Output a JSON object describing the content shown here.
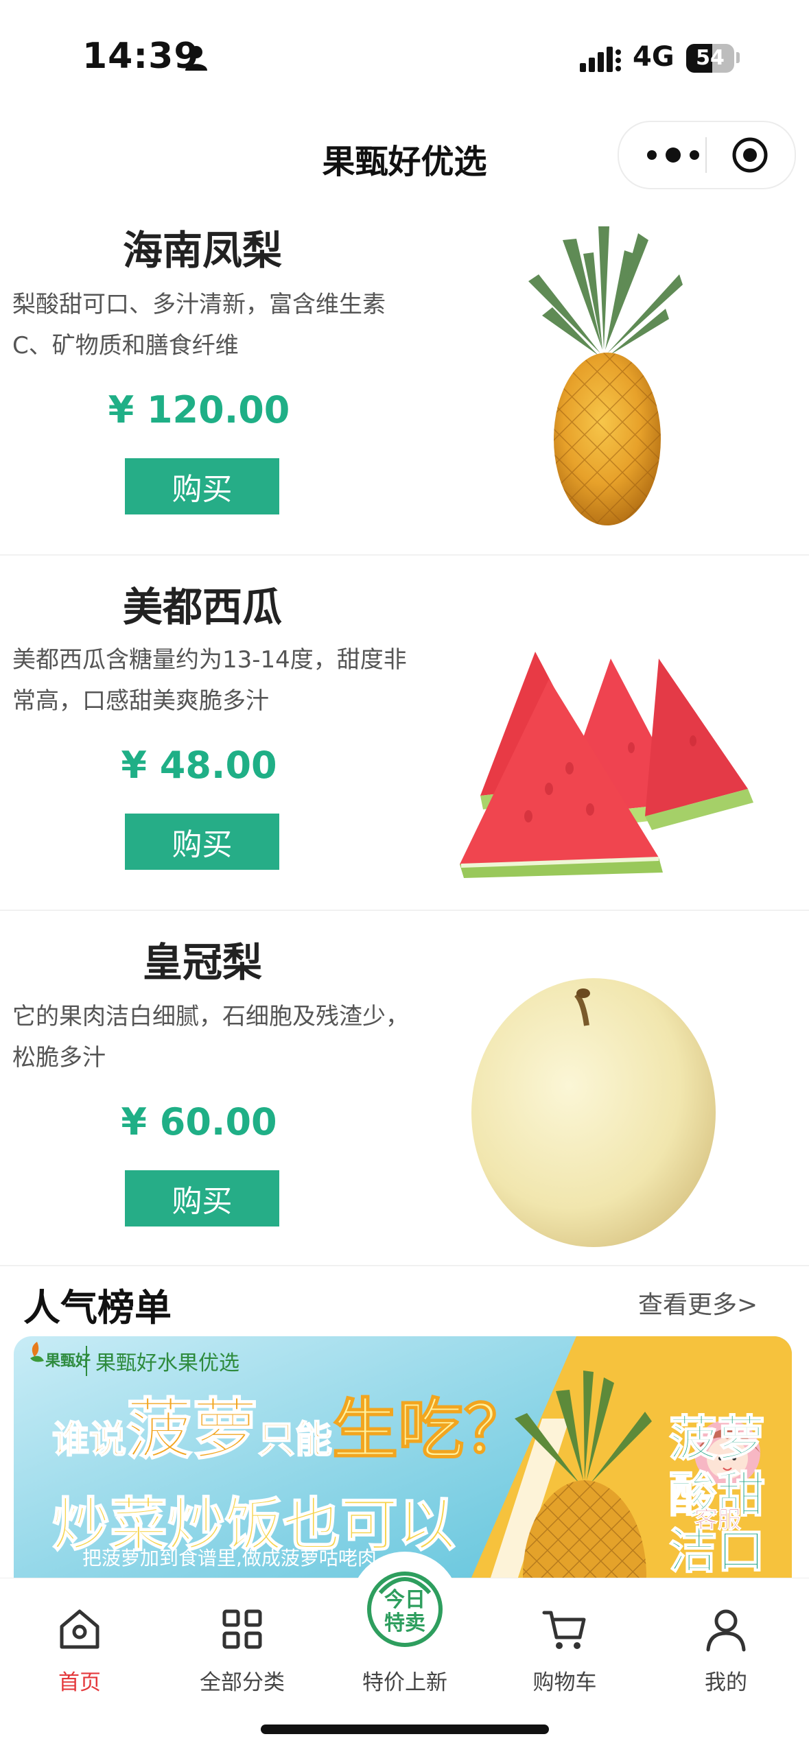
{
  "status_bar": {
    "time": "14:39",
    "network": "4G",
    "battery": "54",
    "battery_level": 0.54
  },
  "nav": {
    "title": "果甄好优选"
  },
  "products": [
    {
      "name": "海南凤梨",
      "desc_line1": "梨酸甜可口、多汁清新，富含维生素",
      "desc_line2": "C、矿物质和膳食纤维",
      "price": "¥ 120.00",
      "buy_label": "购买"
    },
    {
      "name": "美都西瓜",
      "desc_line1": "美都西瓜含糖量约为13-14度，甜度非",
      "desc_line2": "常高，口感甜美爽脆多汁",
      "price": "¥ 48.00",
      "buy_label": "购买"
    },
    {
      "name": "皇冠梨",
      "desc_line1": "它的果肉洁白细腻，石细胞及残渣少，",
      "desc_line2": "松脆多汁",
      "price": "¥ 60.00",
      "buy_label": "购买"
    }
  ],
  "section": {
    "title": "人气榜单",
    "more": "查看更多>"
  },
  "banner": {
    "brand": "果甄好水果优选",
    "logo_text": "果甄好",
    "headline_pre": "谁说",
    "headline_key": "菠萝",
    "headline_mid": "只能",
    "headline_end": "生吃？",
    "headline2": "炒菜炒饭也可以",
    "subtitle": "把菠萝加到食谱里,做成菠萝咕咾肉",
    "side_text": "菠萝酸甜洁口",
    "service_label": "客服"
  },
  "tabbar": {
    "items": [
      {
        "label": "首页",
        "icon": "home-icon",
        "active": true
      },
      {
        "label": "全部分类",
        "icon": "grid-icon",
        "active": false
      },
      {
        "label": "特价上新",
        "icon": "today-special-icon",
        "active": false
      },
      {
        "label": "购物车",
        "icon": "cart-icon",
        "active": false
      },
      {
        "label": "我的",
        "icon": "user-icon",
        "active": false
      }
    ],
    "promo_line1": "今日",
    "promo_line2": "特卖"
  },
  "colors": {
    "accent_green": "#26ad87",
    "price_green": "#1faf86",
    "active_red": "#e4393c"
  }
}
